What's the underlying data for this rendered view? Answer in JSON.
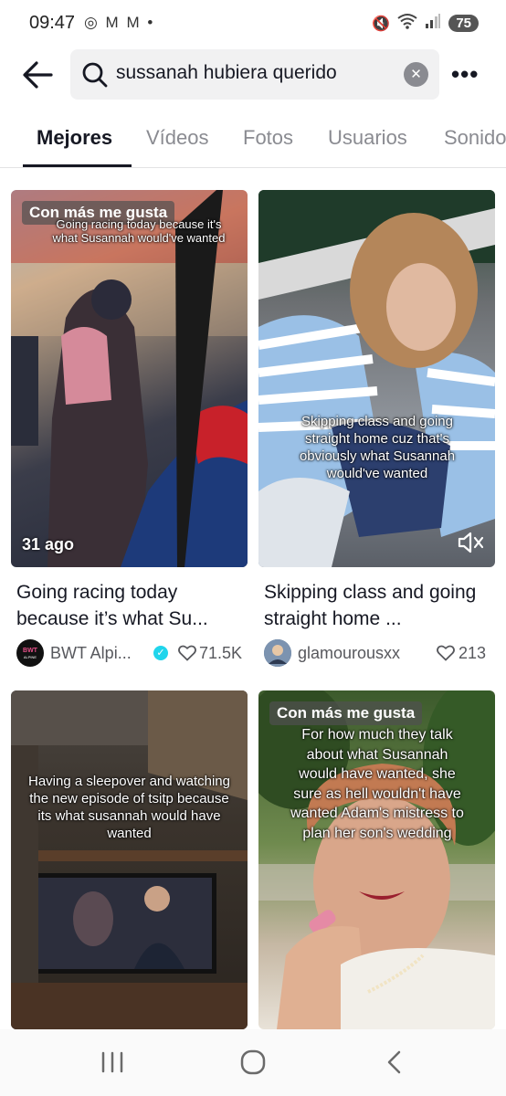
{
  "status_bar": {
    "time": "09:47",
    "left_icons": "◎ M M •",
    "battery": "75"
  },
  "search": {
    "query": "sussanah hubiera querido"
  },
  "tabs": [
    {
      "label": "Mejores",
      "active": true
    },
    {
      "label": "Vídeos",
      "active": false
    },
    {
      "label": "Fotos",
      "active": false
    },
    {
      "label": "Usuarios",
      "active": false
    },
    {
      "label": "Sonidos",
      "active": false
    }
  ],
  "results": [
    {
      "badge": "Con más me gusta",
      "overlay": "Going racing today because it's what Susannah would've wanted",
      "date": "31 ago",
      "title": "Going racing today because it’s what Su...",
      "author": "BWT Alpi...",
      "verified": true,
      "likes": "71.5K"
    },
    {
      "badge": "",
      "overlay": "Skipping class and going straight home cuz that's obviously what Susannah would've wanted",
      "title": "Skipping class and going straight home ...",
      "author": "glamourousxx",
      "verified": false,
      "likes": "213"
    },
    {
      "badge": "",
      "overlay": "Having a sleepover and watching the new episode of tsitp because its what susannah would have wanted"
    },
    {
      "badge": "Con más me gusta",
      "overlay": "For how much they talk about what Susannah would have wanted, she sure as hell wouldn't have wanted Adam's mistress to plan her son's wedding"
    }
  ],
  "icons": {
    "back": "arrow-left-icon",
    "search": "search-icon",
    "clear": "clear-icon",
    "more": "more-icon",
    "mute": "mute-icon",
    "nav_recent": "recents-icon",
    "nav_home": "home-icon",
    "nav_back": "back-icon"
  },
  "colors": {
    "accent_verified": "#20d5ec",
    "text_primary": "#161823",
    "text_secondary": "#8a8b91"
  }
}
